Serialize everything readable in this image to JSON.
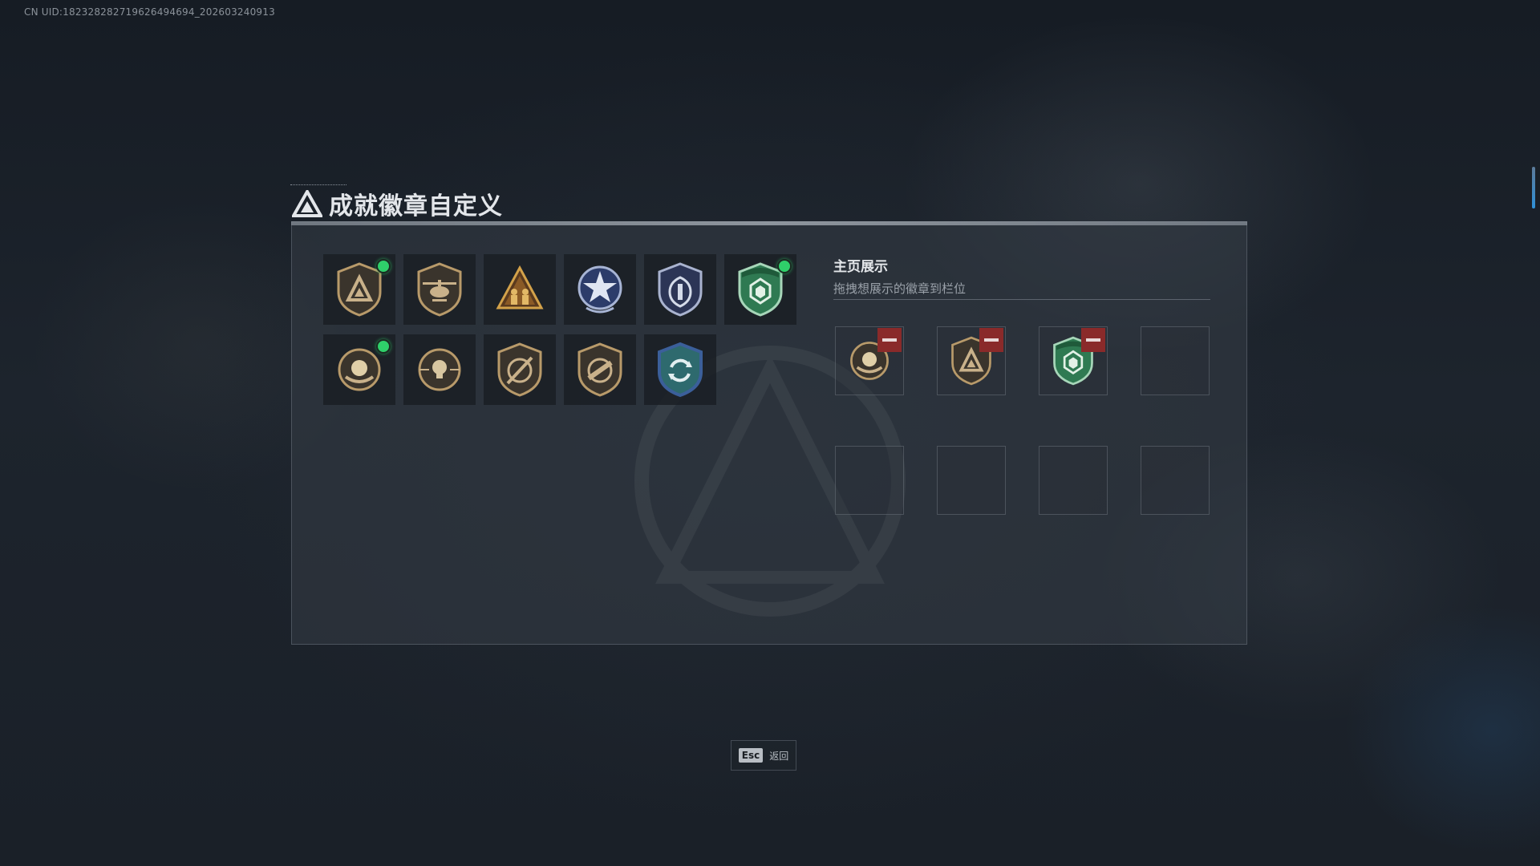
{
  "uid_text": "CN UID:182328282719626494694_202603240913",
  "title": "成就徽章自定义",
  "badges": [
    {
      "icon": "triangle-shield-badge-icon",
      "equipped": true
    },
    {
      "icon": "helicopter-badge-icon",
      "equipped": false
    },
    {
      "icon": "soldiers-triangle-badge-icon",
      "equipped": false
    },
    {
      "icon": "star-wreath-badge-icon",
      "equipped": false
    },
    {
      "icon": "eagle-shield-badge-icon",
      "equipped": false
    },
    {
      "icon": "green-emerald-shield-badge-icon",
      "equipped": true
    },
    {
      "icon": "orb-emblem-badge-icon",
      "equipped": true
    },
    {
      "icon": "skull-crosshair-badge-icon",
      "equipped": false
    },
    {
      "icon": "rifle-shield-badge-icon",
      "equipped": false
    },
    {
      "icon": "assault-rifle-shield-badge-icon",
      "equipped": false
    },
    {
      "icon": "blue-cycle-shield-badge-icon",
      "equipped": false
    }
  ],
  "showcase": {
    "title": "主页展示",
    "subtitle": "拖拽想展示的徽章到栏位",
    "slots": [
      {
        "icon": "orb-emblem-badge-icon",
        "filled": true
      },
      {
        "icon": "triangle-shield-badge-icon",
        "filled": true
      },
      {
        "icon": "green-emerald-shield-badge-icon",
        "filled": true
      },
      {
        "icon": "",
        "filled": false
      },
      {
        "icon": "",
        "filled": false
      },
      {
        "icon": "",
        "filled": false
      },
      {
        "icon": "",
        "filled": false
      },
      {
        "icon": "",
        "filled": false
      }
    ]
  },
  "esc": {
    "key": "Esc",
    "label": "返回"
  },
  "colors": {
    "equipped_dot": "#2fcf6a",
    "remove_button": "#8a2a2a",
    "bronze": "#b89a6a",
    "green_badge": "#2f7a52",
    "blue_badge": "#3b5f9a"
  }
}
